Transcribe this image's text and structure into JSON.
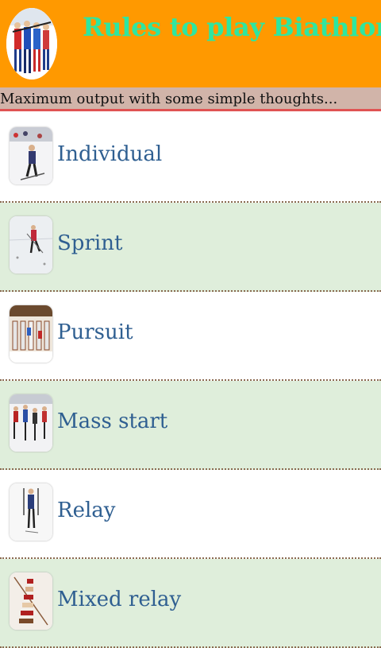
{
  "header": {
    "title": "Rules to play Biathlon",
    "logo_icon": "biathletes-logo-icon",
    "background_color": "#ff9900",
    "title_color": "#2ee6a0"
  },
  "tagline": {
    "text": "Maximum output with some simple thoughts..."
  },
  "menu": {
    "items": [
      {
        "label": "Individual",
        "thumbnail_icon": "skier-photo-icon"
      },
      {
        "label": "Sprint",
        "thumbnail_icon": "skier-photo-icon"
      },
      {
        "label": "Pursuit",
        "thumbnail_icon": "athletes-photo-icon"
      },
      {
        "label": "Mass start",
        "thumbnail_icon": "athletes-photo-icon"
      },
      {
        "label": "Relay",
        "thumbnail_icon": "skier-photo-icon"
      },
      {
        "label": "Mixed relay",
        "thumbnail_icon": "athletes-photo-icon"
      }
    ]
  }
}
